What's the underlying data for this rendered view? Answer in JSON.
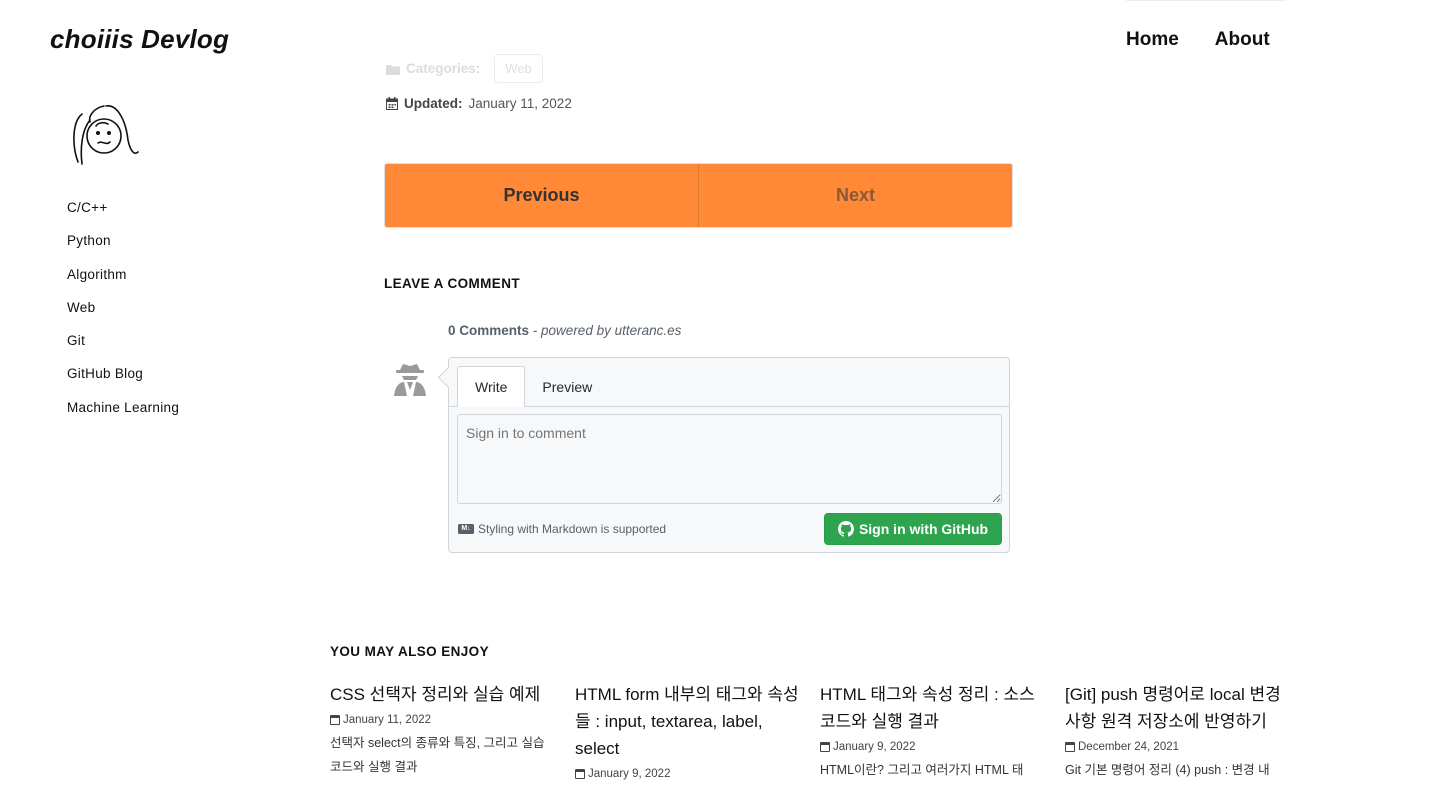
{
  "site": {
    "title": "choiiis Devlog"
  },
  "topnav": {
    "home": "Home",
    "about": "About"
  },
  "sidebar": {
    "items": [
      "C/C++",
      "Python",
      "Algorithm",
      "Web",
      "Git",
      "GitHub Blog",
      "Machine Learning"
    ]
  },
  "post_meta": {
    "categories_label": "Categories:",
    "category": "Web",
    "updated_label": "Updated:",
    "updated_date": "January 11, 2022"
  },
  "pager": {
    "previous": "Previous",
    "next": "Next"
  },
  "comments": {
    "section_title": "LEAVE A COMMENT",
    "count": "0 Comments",
    "powered_by": "- powered by utteranc.es",
    "tab_write": "Write",
    "tab_preview": "Preview",
    "placeholder": "Sign in to comment",
    "markdown_note": "Styling with Markdown is supported",
    "signin_button": "Sign in with GitHub"
  },
  "related": {
    "section_title": "YOU MAY ALSO ENJOY",
    "posts": [
      {
        "title": "CSS 선택자 정리와 실습 예제",
        "date": "January 11, 2022",
        "excerpt": "선택자 select의 종류와 특징, 그리고 실습 코드와 실행 결과"
      },
      {
        "title": "HTML form 내부의 태그와 속성들 : input, textarea, label, select",
        "date": "January 9, 2022",
        "excerpt": ""
      },
      {
        "title": "HTML 태그와 속성 정리 : 소스코드와 실행 결과",
        "date": "January 9, 2022",
        "excerpt": "HTML이란? 그리고 여러가지 HTML 태"
      },
      {
        "title": "[Git] push 명령어로 local 변경 사항 원격 저장소에 반영하기",
        "date": "December 24, 2021",
        "excerpt": "Git 기본 명령어 정리 (4) push : 변경 내"
      }
    ]
  },
  "colors": {
    "pager_bg": "#ff8936",
    "github_button": "#2ea44f"
  }
}
